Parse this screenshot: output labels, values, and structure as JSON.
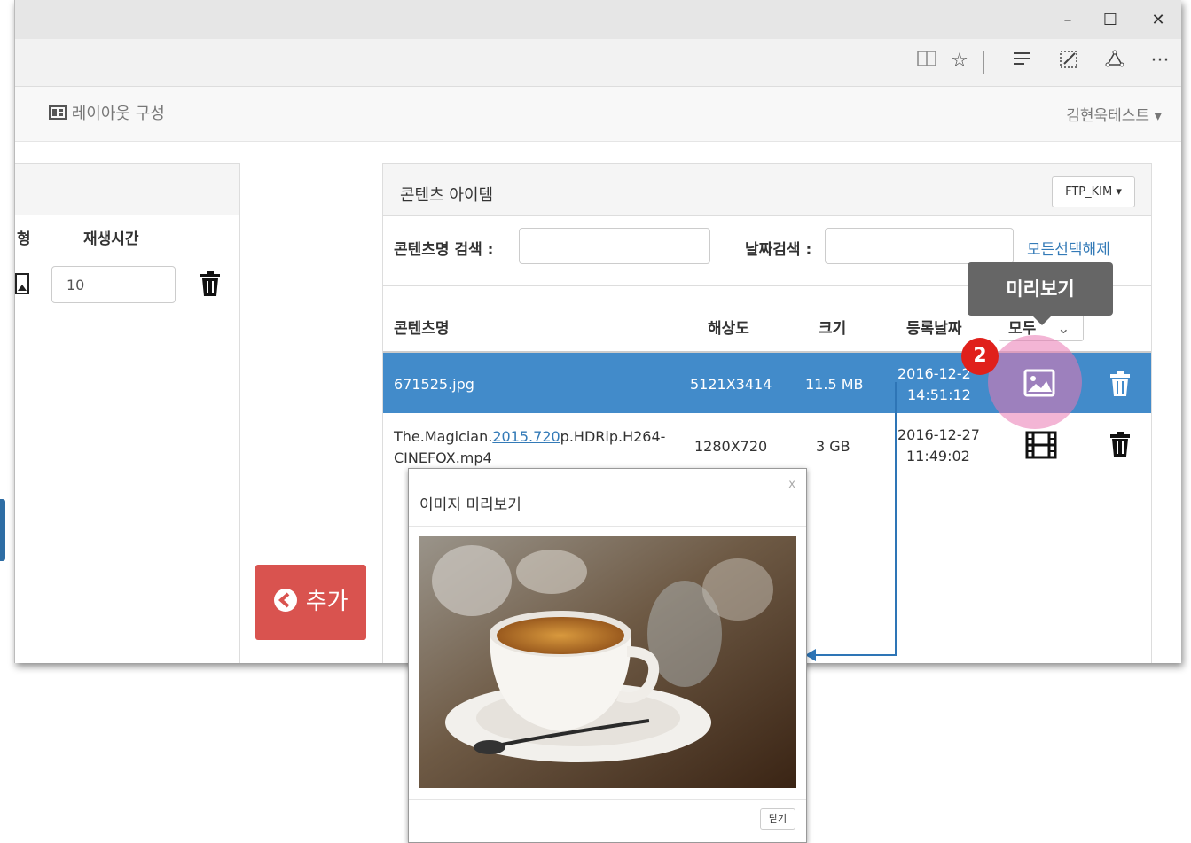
{
  "window": {
    "controls": {
      "minimize": "–",
      "maximize": "☐",
      "close": "✕"
    },
    "toolbar_icons": [
      "reading-view-icon",
      "favorite-star-icon",
      "hub-icon",
      "web-note-icon",
      "share-icon",
      "more-icon"
    ],
    "more_label": "···"
  },
  "navbar": {
    "layout_label": "레이아웃 구성",
    "user_label": "김현욱테스트 ▾"
  },
  "left_panel": {
    "col_type_partial": "형",
    "col_play_time": "재생시간",
    "row": {
      "play_time": "10"
    }
  },
  "add_button": {
    "label": "추가"
  },
  "right_panel": {
    "title": "콘텐츠 아이템",
    "ftp_dropdown": "FTP_KIM ▾",
    "search_name_label": "콘텐츠명 검색 :",
    "search_date_label": "날짜검색 :",
    "clear_selection": "모든선택해제",
    "columns": {
      "name": "콘텐츠명",
      "resolution": "해상도",
      "size": "크기",
      "date": "등록날짜",
      "all_partial": "모두"
    },
    "rows": [
      {
        "name": "671525.jpg",
        "resolution": "5121X3414",
        "size": "11.5 MB",
        "date": "2016-12-2",
        "time": "14:51:12",
        "type": "image"
      },
      {
        "name_prefix": "The.Magician.",
        "name_link": "2015.720",
        "name_suffix": "p.HDRip.H264-",
        "name_line2": "CINEFOX.mp4",
        "resolution": "1280X720",
        "size": "3 GB",
        "date": "2016-12-27",
        "time": "11:49:02",
        "type": "video"
      }
    ]
  },
  "tooltip": {
    "label": "미리보기"
  },
  "step_badge": {
    "number": "2"
  },
  "modal": {
    "title": "이미지 미리보기",
    "close_x": "x",
    "close_button": "닫기"
  },
  "colors": {
    "selected_row": "#428bca",
    "add_button": "#d9534f",
    "badge": "#e0201b",
    "tooltip": "#666666",
    "link": "#337ab7"
  }
}
